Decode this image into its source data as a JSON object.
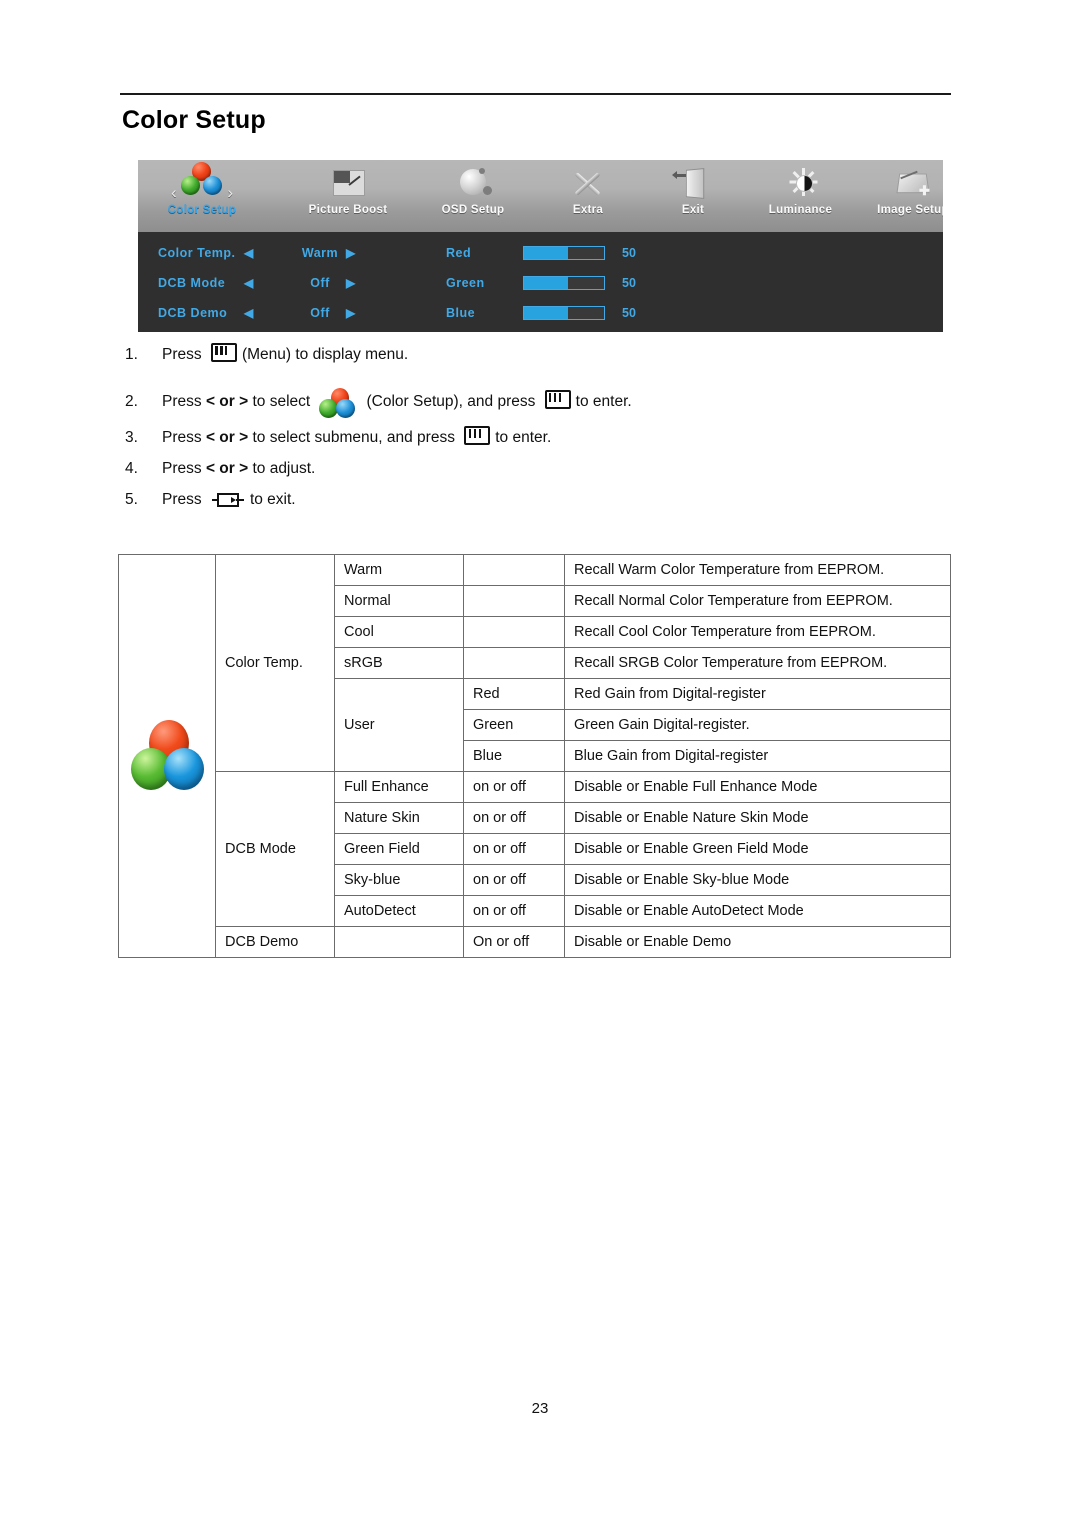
{
  "document": {
    "page_title": "Color Setup",
    "page_number": "23"
  },
  "osd": {
    "top_menu": [
      {
        "label": "Color Setup",
        "icon": "color-balls-icon",
        "selected": true
      },
      {
        "label": "Picture Boost",
        "icon": "picture-boost-icon",
        "selected": false
      },
      {
        "label": "OSD Setup",
        "icon": "osd-setup-icon",
        "selected": false
      },
      {
        "label": "Extra",
        "icon": "extra-tools-icon",
        "selected": false
      },
      {
        "label": "Exit",
        "icon": "exit-door-icon",
        "selected": false
      },
      {
        "label": "Luminance",
        "icon": "sun-brightness-icon",
        "selected": false
      },
      {
        "label": "Image Setup",
        "icon": "image-setup-icon",
        "selected": false
      }
    ],
    "left_arrow": "‹",
    "right_arrow": "›",
    "rows": [
      {
        "name": "Color Temp.",
        "left": "◀",
        "value": "Warm",
        "right": "▶"
      },
      {
        "name": "DCB Mode",
        "left": "◀",
        "value": "Off",
        "right": "▶"
      },
      {
        "name": "DCB Demo",
        "left": "◀",
        "value": "Off",
        "right": "▶"
      }
    ],
    "channels": [
      {
        "name": "Red",
        "value": "50",
        "fill_percent": 55
      },
      {
        "name": "Green",
        "value": "50",
        "fill_percent": 55
      },
      {
        "name": "Blue",
        "value": "50",
        "fill_percent": 55
      }
    ],
    "accent_color": "#41a9e6",
    "panel_color": "#2f2f2f"
  },
  "steps": [
    {
      "num": "1.",
      "pre": "Press ",
      "icon": "menu-button-icon",
      "post": "(Menu) to display menu."
    },
    {
      "num": "2.",
      "pre": "Press ",
      "bold": "< or >",
      "mid": " to select ",
      "icon": "color-balls-icon",
      "mid2": "(Color Setup), and press ",
      "icon2": "menu-button-icon",
      "post": "to enter."
    },
    {
      "num": "3.",
      "pre": "Press ",
      "bold": "< or >",
      "mid": " to select submenu, and press ",
      "icon": "menu-button-icon",
      "post": "to enter."
    },
    {
      "num": "4.",
      "pre": "Press ",
      "bold": "< or >",
      "mid": " to adjust.",
      "post": ""
    },
    {
      "num": "5.",
      "pre": "Press ",
      "icon": "exit-button-icon",
      "post": "to exit."
    }
  ],
  "table": {
    "rows": [
      {
        "group": "Color Temp.",
        "item": "Warm",
        "value": "",
        "desc": "Recall Warm Color Temperature from EEPROM."
      },
      {
        "group": "",
        "item": "Normal",
        "value": "",
        "desc": "Recall Normal Color Temperature from EEPROM."
      },
      {
        "group": "",
        "item": "Cool",
        "value": "",
        "desc": "Recall Cool Color Temperature from EEPROM."
      },
      {
        "group": "",
        "item": "sRGB",
        "value": "",
        "desc": "Recall SRGB Color Temperature from EEPROM."
      },
      {
        "group": "",
        "item": "User",
        "value": "Red",
        "desc": "Red Gain from Digital-register"
      },
      {
        "group": "",
        "item": "",
        "value": "Green",
        "desc": "Green Gain Digital-register."
      },
      {
        "group": "",
        "item": "",
        "value": "Blue",
        "desc": "Blue Gain from Digital-register"
      },
      {
        "group": "DCB Mode",
        "item": "Full Enhance",
        "value": "on or off",
        "desc": "Disable or Enable Full Enhance Mode"
      },
      {
        "group": "",
        "item": "Nature Skin",
        "value": "on or off",
        "desc": "Disable or Enable Nature Skin Mode"
      },
      {
        "group": "",
        "item": "Green Field",
        "value": "on or off",
        "desc": "Disable or Enable Green Field Mode"
      },
      {
        "group": "",
        "item": "Sky-blue",
        "value": "on or off",
        "desc": "Disable or Enable Sky-blue Mode"
      },
      {
        "group": "",
        "item": "AutoDetect",
        "value": "on or off",
        "desc": "Disable or Enable AutoDetect Mode"
      },
      {
        "group": "DCB Demo",
        "item": "",
        "value": "On or off",
        "desc": "Disable or Enable Demo"
      }
    ]
  }
}
